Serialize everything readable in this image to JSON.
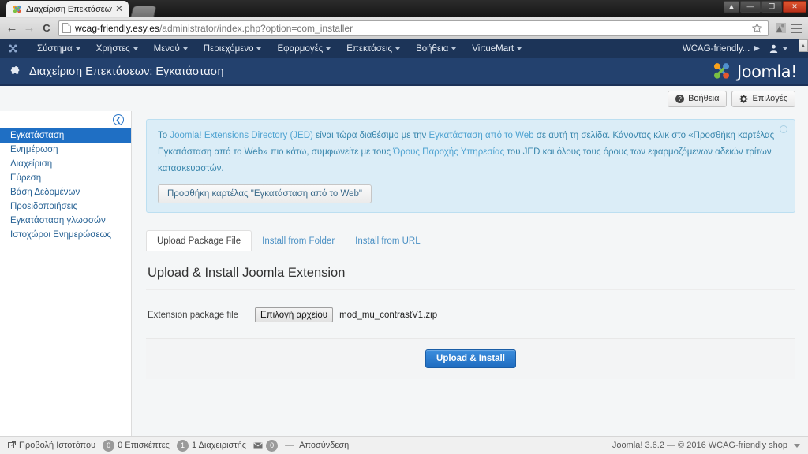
{
  "browser": {
    "tab": {
      "title": "Διαχείριση Επεκτάσεων: Ε",
      "close_label": "✕",
      "favicon": "joomla-favicon"
    },
    "nav": {
      "back": "←",
      "forward": "→",
      "reload": "C"
    },
    "url": {
      "host": "wcag-friendly.esy.es",
      "path": "/administrator/index.php?option=com_installer"
    },
    "toolbar_icons": [
      "star-icon",
      "extension-icon",
      "menu-icon"
    ],
    "window_controls": {
      "restore": "▲",
      "minimize": "—",
      "maximize": "❐",
      "close": "✕"
    }
  },
  "adminbar": {
    "brand_icon": "joomla-glyph-icon",
    "items": [
      {
        "label": "Σύστημα",
        "caret": true
      },
      {
        "label": "Χρήστες",
        "caret": true
      },
      {
        "label": "Μενού",
        "caret": true
      },
      {
        "label": "Περιεχόμενο",
        "caret": true
      },
      {
        "label": "Εφαρμογές",
        "caret": true
      },
      {
        "label": "Επεκτάσεις",
        "caret": true
      },
      {
        "label": "Βοήθεια",
        "caret": true
      },
      {
        "label": "VirtueMart",
        "caret": true
      }
    ],
    "site_link": "WCAG-friendly...",
    "user_icon": "user-icon"
  },
  "header": {
    "icon": "puzzle-piece-icon",
    "title": "Διαχείριση Επεκτάσεων: Εγκατάσταση",
    "logo_text": "Joomla!"
  },
  "toolbar": {
    "help_label": "Βοήθεια",
    "options_label": "Επιλογές",
    "help_icon": "question-mark-icon",
    "options_icon": "gear-icon"
  },
  "sidebar": {
    "collapse_icon": "chevron-left-circle-icon",
    "items": [
      {
        "label": "Εγκατάσταση",
        "active": true
      },
      {
        "label": "Ενημέρωση",
        "active": false
      },
      {
        "label": "Διαχείριση",
        "active": false
      },
      {
        "label": "Εύρεση",
        "active": false
      },
      {
        "label": "Βάση Δεδομένων",
        "active": false
      },
      {
        "label": "Προειδοποιήσεις",
        "active": false
      },
      {
        "label": "Εγκατάσταση γλωσσών",
        "active": false
      },
      {
        "label": "Ιστοχώροι Ενημερώσεως",
        "active": false
      }
    ]
  },
  "alert": {
    "line1_pre": "Το ",
    "link1": "Joomla! Extensions Directory (JED)",
    "line1_mid": " είναι τώρα διαθέσιμο με την ",
    "link2": "Εγκατάσταση από το Web",
    "line1_post": " σε αυτή τη σελίδα. Κάνοντας κλικ στο «Προσθήκη καρτέλας Εγκατάσταση από το Web» πιο κάτω, συμφωνείτε με τους ",
    "link3": "Όρους Παροχής Υπηρεσίας",
    "line2_post": " του JED και όλους τους όρους των εφαρμοζόμενων αδειών τρίτων κατασκευαστών.",
    "button_label": "Προσθήκη καρτέλας \"Εγκατάσταση από το Web\"",
    "close_icon": "close-circle-icon"
  },
  "tabs": [
    {
      "label": "Upload Package File",
      "active": true
    },
    {
      "label": "Install from Folder",
      "active": false
    },
    {
      "label": "Install from URL",
      "active": false
    }
  ],
  "panel": {
    "heading": "Upload & Install Joomla Extension",
    "field_label": "Extension package file",
    "file_button_label": "Επιλογή αρχείου",
    "file_name": "mod_mu_contrastV1.zip",
    "submit_label": "Upload & Install"
  },
  "statusbar": {
    "view_site_label": "Προβολή Ιστοτόπου",
    "view_site_icon": "external-link-icon",
    "visitors_count": "0",
    "visitors_label": "0 Επισκέπτες",
    "admins_count": "1",
    "admins_label": "1 Διαχειριστής",
    "messages_icon": "envelope-icon",
    "messages_count": "0",
    "logout_label": "Αποσύνδεση",
    "separator": "—",
    "copyright": "Joomla! 3.6.2  —  © 2016 WCAG-friendly shop"
  },
  "colors": {
    "admin_nav": "#1c3458",
    "sub_header": "#23416e",
    "accent": "#1f6fc4",
    "alert_bg": "#dbedf7",
    "alert_text": "#3a87ad",
    "link": "#2a6496"
  }
}
